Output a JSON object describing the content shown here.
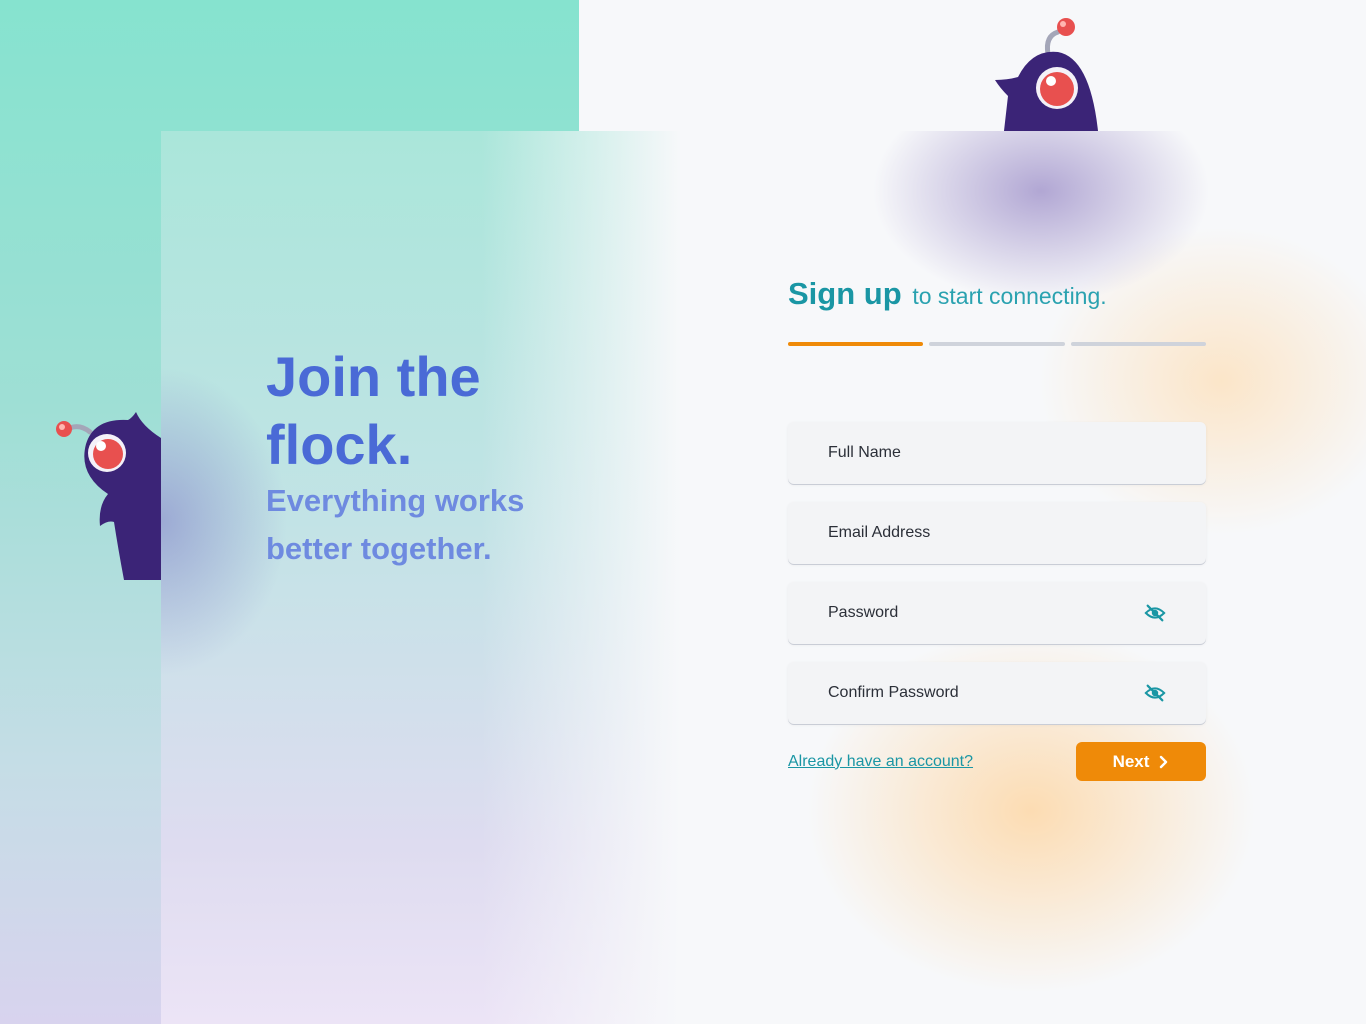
{
  "hero": {
    "title": "Join the flock.",
    "subtitle": "Everything works better together."
  },
  "form": {
    "heading_strong": "Sign up",
    "heading_light": "to start connecting.",
    "steps_total": 3,
    "step_current": 1,
    "fields": [
      {
        "placeholder": "Full Name",
        "type": "text"
      },
      {
        "placeholder": "Email Address",
        "type": "email"
      },
      {
        "placeholder": "Password",
        "type": "password",
        "visibility_icon": "eye-off-icon"
      },
      {
        "placeholder": "Confirm Password",
        "type": "password",
        "visibility_icon": "eye-off-icon"
      }
    ],
    "login_link": "Already have an account?",
    "next_label": "Next",
    "next_icon": "chevron-right-icon"
  },
  "colors": {
    "accent_orange": "#ef8a08",
    "teal": "#1a96a4",
    "hero_blue": "#4a6ad6",
    "mascot_purple": "#3b2477",
    "mascot_eye": "#e8504f"
  }
}
